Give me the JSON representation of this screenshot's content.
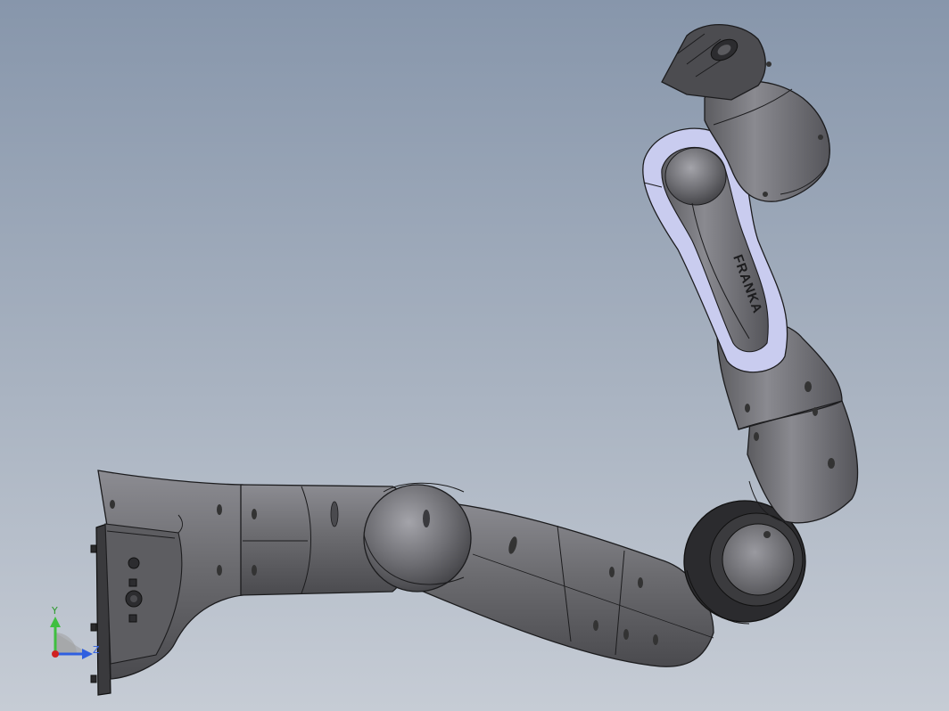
{
  "viewport": {
    "background_top": "#8796ab",
    "background_bottom": "#c6ccd5"
  },
  "model": {
    "body_color": "#6e6e72",
    "highlight_color": "#9a9aa0",
    "edge_color": "#1c1c1e",
    "ring_color": "#c9ccef",
    "logo_text": "FRANKA"
  },
  "triad": {
    "y_label": "Y",
    "z_label": "Z",
    "y_color": "#3fbf3f",
    "z_color": "#2f5fe0",
    "x_color": "#d02020",
    "icons": [
      "y-axis-arrow-icon",
      "z-axis-arrow-icon",
      "x-axis-dot-icon"
    ]
  }
}
